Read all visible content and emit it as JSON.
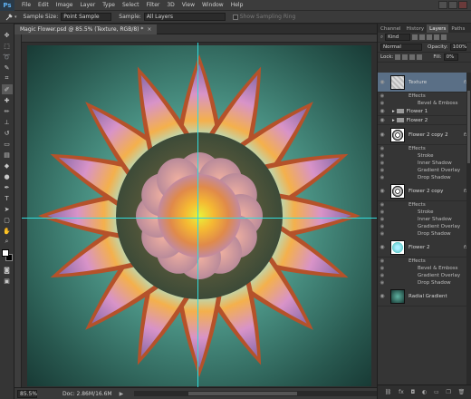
{
  "app": {
    "logo": "Ps",
    "menu": [
      "File",
      "Edit",
      "Image",
      "Layer",
      "Type",
      "Select",
      "Filter",
      "3D",
      "View",
      "Window",
      "Help"
    ]
  },
  "options": {
    "sample_size_label": "Sample Size:",
    "sample_size_value": "Point Sample",
    "sample_label": "Sample:",
    "sample_value": "All Layers",
    "show_ring_label": "Show Sampling Ring"
  },
  "document": {
    "tab_title": "Magic Flower.psd @ 85.5% (Texture, RGB/8) *",
    "close": "×"
  },
  "status": {
    "zoom": "85.5%",
    "doc_info": "Doc: 2.86M/16.6M",
    "arrow": "▶"
  },
  "panels": {
    "tabs": [
      "Channel",
      "History",
      "Layers",
      "Paths"
    ],
    "active_tab": "Layers",
    "kind_label": "Kind",
    "blend_mode": "Normal",
    "opacity_label": "Opacity:",
    "opacity_value": "100%",
    "lock_label": "Lock:",
    "fill_label": "Fill:",
    "fill_value": "0%"
  },
  "layers": [
    {
      "type": "layer",
      "name": "Texture",
      "fx": "fx",
      "selected": true
    },
    {
      "type": "effects",
      "label": "Effects"
    },
    {
      "type": "effect",
      "label": "Bevel & Emboss"
    },
    {
      "type": "group",
      "name": "Flower 1"
    },
    {
      "type": "group",
      "name": "Flower 2"
    },
    {
      "type": "layer",
      "name": "Flower 2 copy 2",
      "fx": "fx"
    },
    {
      "type": "effects",
      "label": "Effects"
    },
    {
      "type": "effect",
      "label": "Stroke"
    },
    {
      "type": "effect",
      "label": "Inner Shadow"
    },
    {
      "type": "effect",
      "label": "Gradient Overlay"
    },
    {
      "type": "effect",
      "label": "Drop Shadow"
    },
    {
      "type": "layer",
      "name": "Flower 2 copy",
      "fx": "fx"
    },
    {
      "type": "effects",
      "label": "Effects"
    },
    {
      "type": "effect",
      "label": "Stroke"
    },
    {
      "type": "effect",
      "label": "Inner Shadow"
    },
    {
      "type": "effect",
      "label": "Gradient Overlay"
    },
    {
      "type": "effect",
      "label": "Drop Shadow"
    },
    {
      "type": "layer",
      "name": "Flower 2",
      "fx": "fx"
    },
    {
      "type": "effects",
      "label": "Effects"
    },
    {
      "type": "effect",
      "label": "Bevel & Emboss"
    },
    {
      "type": "effect",
      "label": "Gradient Overlay"
    },
    {
      "type": "effect",
      "label": "Drop Shadow"
    },
    {
      "type": "layer",
      "name": "Radial Gradient",
      "fx": ""
    }
  ],
  "colors": {
    "canvas_center": "#5fb2a1",
    "canvas_edge": "#183a35",
    "guide": "#33dadb",
    "selection": "#5a6f86"
  }
}
